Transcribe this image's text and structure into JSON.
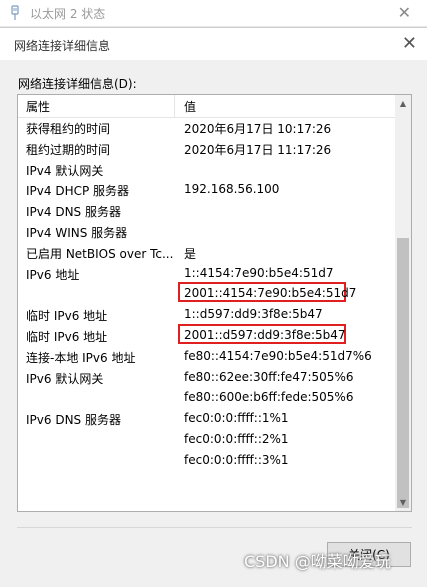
{
  "parent_window": {
    "title": "以太网 2 状态",
    "close_glyph": "✕"
  },
  "dialog": {
    "title": "网络连接详细信息",
    "close_glyph": "✕",
    "group_label": "网络连接详细信息(D):",
    "columns": [
      "属性",
      "值"
    ],
    "rows": [
      {
        "property": "获得租约的时间",
        "value": "2020年6月17日 10:17:26",
        "highlight": false
      },
      {
        "property": "租约过期的时间",
        "value": "2020年6月17日 11:17:26",
        "highlight": false
      },
      {
        "property": "IPv4 默认网关",
        "value": "",
        "highlight": false
      },
      {
        "property": "IPv4 DHCP 服务器",
        "value": "192.168.56.100",
        "highlight": false
      },
      {
        "property": "IPv4 DNS 服务器",
        "value": "",
        "highlight": false
      },
      {
        "property": "IPv4 WINS 服务器",
        "value": "",
        "highlight": false
      },
      {
        "property": "已启用 NetBIOS over Tc...",
        "value": "是",
        "highlight": false
      },
      {
        "property": "IPv6 地址",
        "value": "1::4154:7e90:b5e4:51d7",
        "highlight": false
      },
      {
        "property": "",
        "value": "2001::4154:7e90:b5e4:51d7",
        "highlight": true
      },
      {
        "property": "临时 IPv6 地址",
        "value": "1::d597:dd9:3f8e:5b47",
        "highlight": false
      },
      {
        "property": "临时 IPv6 地址",
        "value": "2001::d597:dd9:3f8e:5b47",
        "highlight": true
      },
      {
        "property": "连接-本地 IPv6 地址",
        "value": "fe80::4154:7e90:b5e4:51d7%6",
        "highlight": false
      },
      {
        "property": "IPv6 默认网关",
        "value": "fe80::62ee:30ff:fe47:505%6",
        "highlight": false
      },
      {
        "property": "",
        "value": "fe80::600e:b6ff:fede:505%6",
        "highlight": false
      },
      {
        "property": "IPv6 DNS 服务器",
        "value": "fec0:0:0:ffff::1%1",
        "highlight": false
      },
      {
        "property": "",
        "value": "fec0:0:0:ffff::2%1",
        "highlight": false
      },
      {
        "property": "",
        "value": "fec0:0:0:ffff::3%1",
        "highlight": false
      }
    ],
    "close_button": "关闭(C)"
  },
  "watermark": "CSDN @呦菜呦爱玩"
}
